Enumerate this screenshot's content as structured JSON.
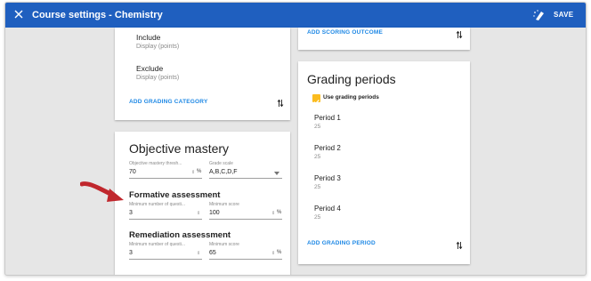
{
  "app_bar": {
    "title": "Course settings - Chemistry",
    "save_label": "SAVE",
    "close_icon": "close-icon",
    "wand_icon": "magic-wand-icon",
    "color": "#1f5fbf"
  },
  "grading_categories": {
    "items": [
      {
        "name": "Include",
        "sub": "Display (points)"
      },
      {
        "name": "Exclude",
        "sub": "Display (points)"
      }
    ],
    "add_label": "ADD GRADING CATEGORY"
  },
  "objective_mastery": {
    "title": "Objective mastery",
    "threshold": {
      "label": "Objective mastery thresh...",
      "value": "70",
      "suffix": "%"
    },
    "grade_scale": {
      "label": "Grade scale",
      "value": "A,B,C,D,F"
    },
    "formative": {
      "title": "Formative assessment",
      "min_questions": {
        "label": "Minimum number of questi...",
        "value": "3"
      },
      "min_score": {
        "label": "Minimum score",
        "value": "100",
        "suffix": "%"
      }
    },
    "remediation": {
      "title": "Remediation assessment",
      "min_questions": {
        "label": "Minimum number of questi...",
        "value": "3"
      },
      "min_score": {
        "label": "Minimum score",
        "value": "65",
        "suffix": "%"
      }
    }
  },
  "scoring": {
    "add_label": "ADD SCORING OUTCOME"
  },
  "grading_periods": {
    "title": "Grading periods",
    "use_periods_label": "Use grading periods",
    "use_periods_checked": true,
    "checkbox_color": "#fbbc1f",
    "periods": [
      {
        "name": "Period 1",
        "value": "25"
      },
      {
        "name": "Period 2",
        "value": "25"
      },
      {
        "name": "Period 3",
        "value": "25"
      },
      {
        "name": "Period 4",
        "value": "25"
      }
    ],
    "add_label": "ADD GRADING PERIOD"
  },
  "annotation": {
    "arrow_color": "#c0272d"
  }
}
